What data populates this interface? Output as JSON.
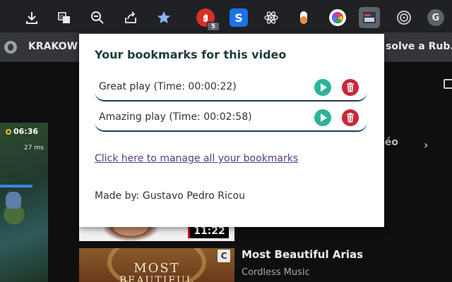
{
  "browser": {
    "extension_badge_count": "5",
    "extension_s_label": "S",
    "extension_g_label": "G"
  },
  "bookmarks_bar": {
    "items": [
      "KRAKOW",
      "solve a Rub..."
    ]
  },
  "page": {
    "game_clock": "06:36",
    "game_ping": "27 ms",
    "videos_label_fragment": "léo",
    "duration_badge": "11:22",
    "thumb_text_line1": "MOST",
    "thumb_text_line2": "BEAUTIFUL",
    "c_badge": "C",
    "next_video_title": "Most Beautiful Arias",
    "next_video_channel": "Cordless Music"
  },
  "popup": {
    "title": "Your bookmarks for this video",
    "bookmarks": [
      {
        "label": "Great play (Time: 00:00:22)"
      },
      {
        "label": "Amazing play (Time: 00:02:58)"
      }
    ],
    "manage_link": "Click here to manage all your bookmarks",
    "credit": "Made by: Gustavo Pedro Ricou"
  },
  "colors": {
    "play_button": "#2cb39a",
    "delete_button": "#c8283a",
    "title_text": "#1f3a3c",
    "row_underline": "#1f3c56",
    "link": "#5a3a8a"
  }
}
